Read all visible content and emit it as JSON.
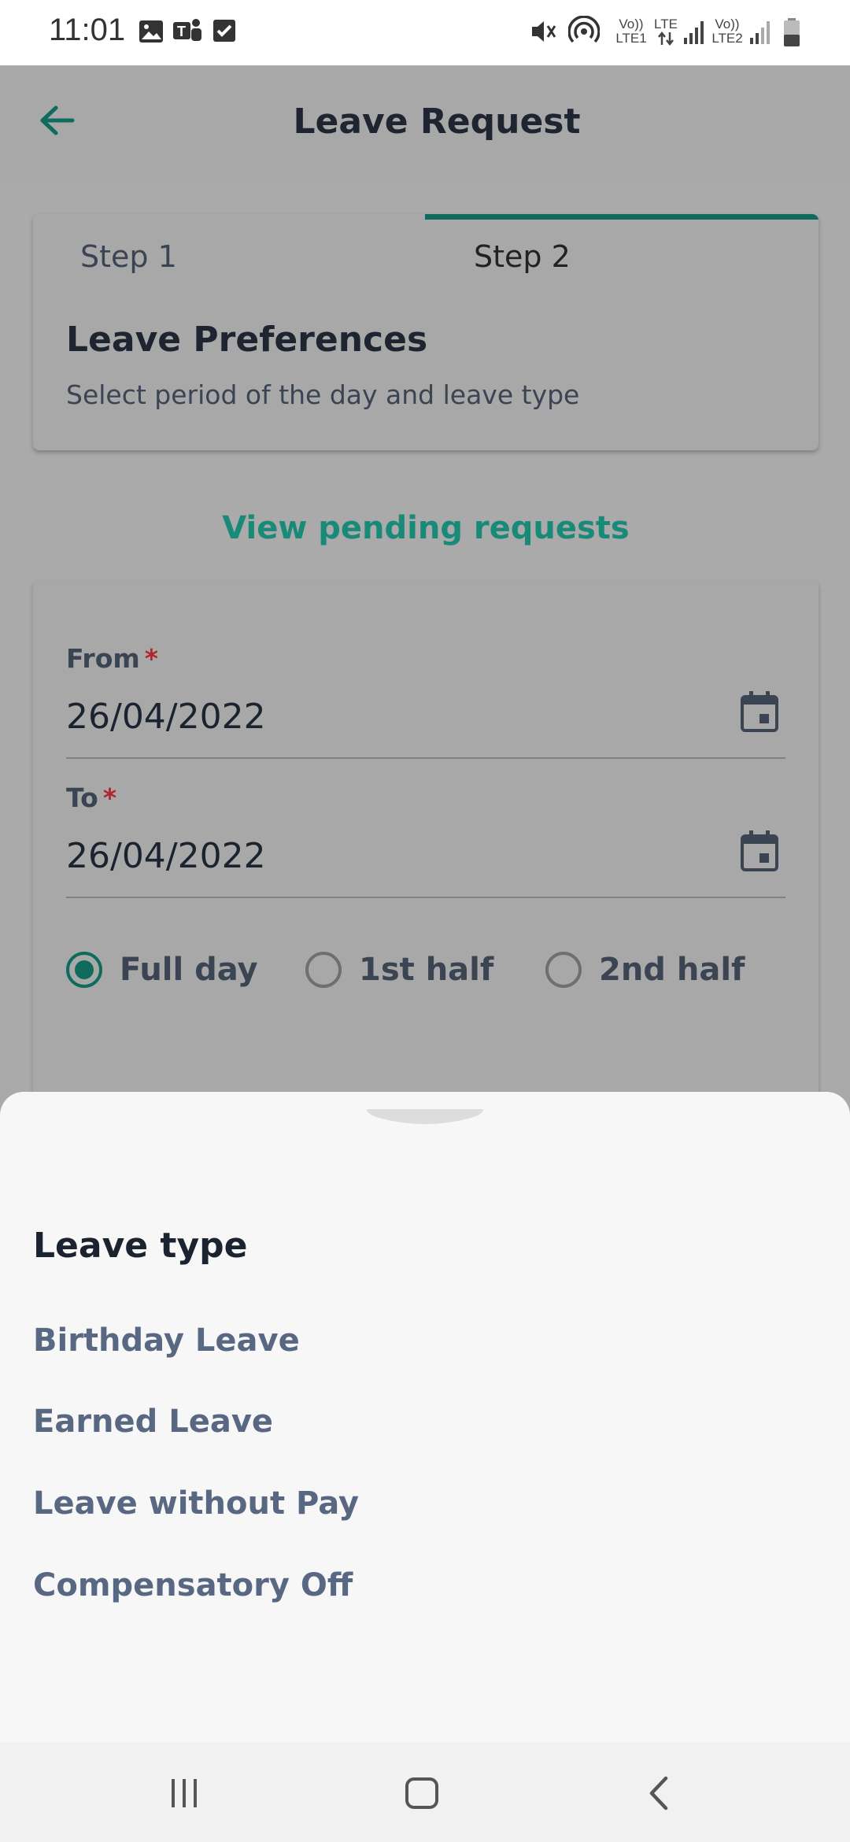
{
  "status_bar": {
    "time": "11:01",
    "icons": [
      "gallery-icon",
      "teams-icon",
      "checkbox-icon",
      "mute-icon",
      "hotspot-icon",
      "signal-sim1-icon",
      "signal-sim2-icon",
      "battery-icon"
    ],
    "sim1_line1": "Vo))",
    "sim1_line2": "LTE1",
    "lte_label": "LTE",
    "sim2_line1": "Vo))",
    "sim2_line2": "LTE2"
  },
  "app_bar": {
    "title": "Leave Request",
    "back_icon": "arrow-left-icon"
  },
  "steps": {
    "step1": "Step 1",
    "step2": "Step 2",
    "active_step": 2,
    "title": "Leave Preferences",
    "subtitle": "Select period of the day and leave type"
  },
  "pending_link": "View pending requests",
  "form": {
    "from_label": "From",
    "from_value": "26/04/2022",
    "to_label": "To",
    "to_value": "26/04/2022",
    "required_mark": "*",
    "calendar_icon": "calendar-icon",
    "period_options": [
      "Full day",
      "1st half",
      "2nd half"
    ],
    "selected_period": "Full day"
  },
  "sheet": {
    "title": "Leave type",
    "items": [
      "Birthday Leave",
      "Earned Leave",
      "Leave without Pay",
      "Compensatory Off"
    ]
  },
  "nav_bar": {
    "icons": [
      "recents-icon",
      "home-icon",
      "back-icon"
    ]
  },
  "colors": {
    "accent": "#0f6b5e",
    "link": "#1a8a78",
    "required": "#b0262a",
    "overlay_bg": "#aaaaaa",
    "sheet_bg": "#f7f7f7"
  }
}
